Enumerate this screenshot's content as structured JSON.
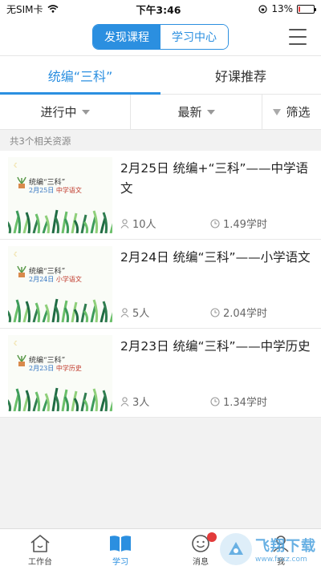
{
  "statusbar": {
    "carrier": "无SIM卡",
    "time": "下午3:46",
    "battery": "13%",
    "battery_level": 0.13
  },
  "header": {
    "seg_discover": "发现课程",
    "seg_study": "学习中心"
  },
  "tabs": [
    {
      "label": "统编“三科”"
    },
    {
      "label": "好课推荐"
    }
  ],
  "filters": {
    "status": "进行中",
    "sort": "最新",
    "filter": "筛选"
  },
  "count_text": "共3个相关资源",
  "courses": [
    {
      "title": "2月25日 统编+“三科”——中学语文",
      "thumb_title": "统编“三科”",
      "thumb_date": "2月25日",
      "thumb_subject": "中学语文",
      "people": "10人",
      "hours": "1.49学时"
    },
    {
      "title": "2月24日 统编“三科”——小学语文",
      "thumb_title": "统编“三科”",
      "thumb_date": "2月24日",
      "thumb_subject": "小学语文",
      "people": "5人",
      "hours": "2.04学时"
    },
    {
      "title": "2月23日 统编“三科”——中学历史",
      "thumb_title": "统编“三科”",
      "thumb_date": "2月23日",
      "thumb_subject": "中学历史",
      "people": "3人",
      "hours": "1.34学时"
    }
  ],
  "bottomnav": [
    {
      "label": "工作台"
    },
    {
      "label": "学习"
    },
    {
      "label": "消息"
    },
    {
      "label": "我"
    }
  ],
  "watermark": {
    "main": "飞翔下载",
    "sub": "www.fxxz.com"
  },
  "colors": {
    "accent": "#2b8fe0",
    "badge": "#e23b3b"
  }
}
